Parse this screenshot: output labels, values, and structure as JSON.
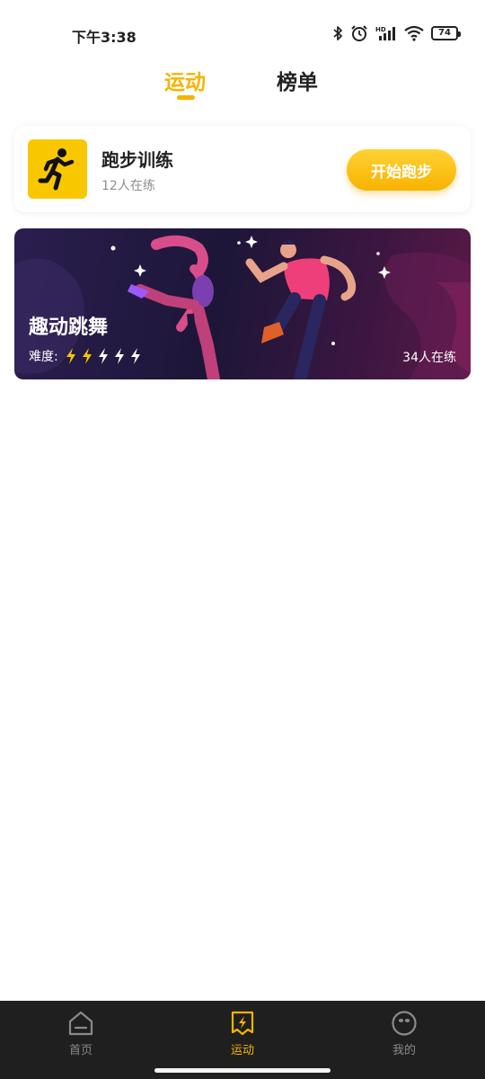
{
  "status_bar": {
    "time": "下午3:38",
    "battery": "74",
    "icons": [
      "bluetooth-icon",
      "alarm-icon",
      "hd-signal-icon",
      "wifi-icon",
      "battery-icon"
    ]
  },
  "tabs": [
    {
      "label": "运动",
      "active": true
    },
    {
      "label": "榜单",
      "active": false
    }
  ],
  "running_card": {
    "title": "跑步训练",
    "count": "12人在练",
    "button": "开始跑步",
    "icon": "running-person-icon"
  },
  "dance_card": {
    "title": "趣动跳舞",
    "difficulty_label": "难度:",
    "difficulty_level": 2,
    "difficulty_max": 5,
    "count": "34人在练"
  },
  "bottom_nav": [
    {
      "label": "首页",
      "icon": "home-icon",
      "active": false
    },
    {
      "label": "运动",
      "icon": "sport-bolt-icon",
      "active": true
    },
    {
      "label": "我的",
      "icon": "profile-face-icon",
      "active": false
    }
  ],
  "colors": {
    "accent": "#f5b400",
    "nav_background": "#1f1f1f",
    "run_icon_background": "#f9c700"
  }
}
